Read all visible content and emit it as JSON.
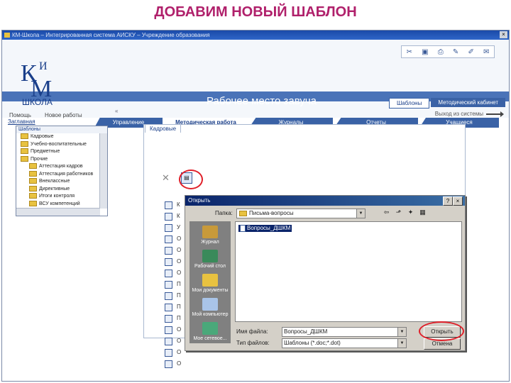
{
  "slide_title": "ДОБАВИМ НОВЫЙ ШАБЛОН",
  "window": {
    "title": "КМ-Школа – Интегрированная система АИСКУ – Учреждение образования"
  },
  "logo": {
    "k": "К",
    "m": "М",
    "i": "И",
    "school": "ШКОЛА"
  },
  "header": {
    "workplace": "Рабочее место завуча",
    "menu_help": "Помощь",
    "menu_new": "Новое работы",
    "logout": "Выход из системы"
  },
  "breadcrumb": "Заглавная",
  "main_tabs": [
    "Управление",
    "Методическая работа",
    "Журналы",
    "Отчеты",
    "Учащиеся"
  ],
  "sub_tabs": [
    "Шаблоны",
    "Методический кабинет"
  ],
  "tree": {
    "title": "Шаблоны",
    "items": [
      "Кадровые",
      "Учебно-воспитательные",
      "Предметные",
      "Прочие",
      "Аттестация кадров",
      "Аттестация работников",
      "Внеклассные",
      "Директивные",
      "Итоги контроля",
      "ВСУ компетенций"
    ]
  },
  "panel": {
    "tab": "Кадровые",
    "list_letters": [
      "К",
      "К",
      "У",
      "О",
      "О",
      "О",
      "О",
      "П",
      "П",
      "П",
      "П",
      "О",
      "О",
      "О",
      "О"
    ]
  },
  "dialog": {
    "title": "Открыть",
    "lookin_label": "Папка:",
    "lookin_value": "Письма-вопросы",
    "file_item": "Вопросы_ДШКМ",
    "places": [
      "Журнал",
      "Рабочий стол",
      "Мои документы",
      "Мой компьютер",
      "Мое сетевое..."
    ],
    "file_name_label": "Имя файла:",
    "file_name_value": "Вопросы_ДШКМ",
    "file_type_label": "Тип файлов:",
    "file_type_value": "Шаблоны (*.doc;*.dot)",
    "open_button": "Открыть",
    "cancel_button": "Отмена"
  }
}
